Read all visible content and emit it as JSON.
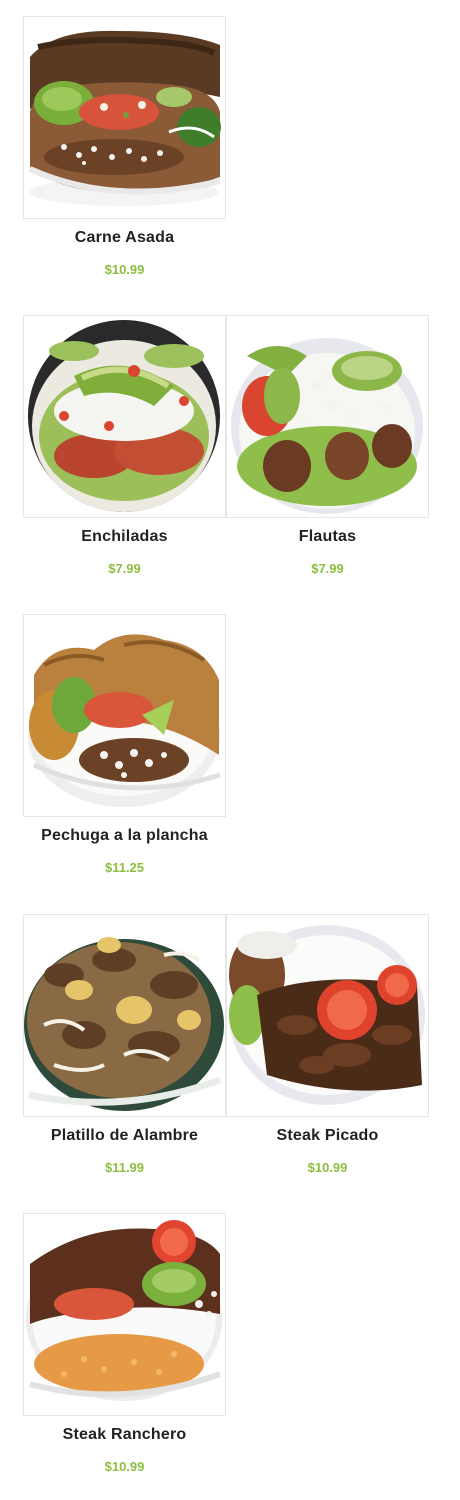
{
  "menu": {
    "items": [
      {
        "name": "Carne Asada",
        "price": "$10.99",
        "image": "carne-asada-plate"
      },
      {
        "name": "Enchiladas",
        "price": "$7.99",
        "image": "enchiladas-plate"
      },
      {
        "name": "Flautas",
        "price": "$7.99",
        "image": "flautas-plate"
      },
      {
        "name": "Pechuga a la plancha",
        "price": "$11.25",
        "image": "pechuga-plate"
      },
      {
        "name": "Platillo de Alambre",
        "price": "$11.99",
        "image": "alambre-plate"
      },
      {
        "name": "Steak Picado",
        "price": "$10.99",
        "image": "steak-picado-plate"
      },
      {
        "name": "Steak Ranchero",
        "price": "$10.99",
        "image": "steak-ranchero-plate"
      }
    ]
  },
  "colors": {
    "price": "#8cbf3f",
    "name": "#222222",
    "border": "#e6e6e6"
  }
}
